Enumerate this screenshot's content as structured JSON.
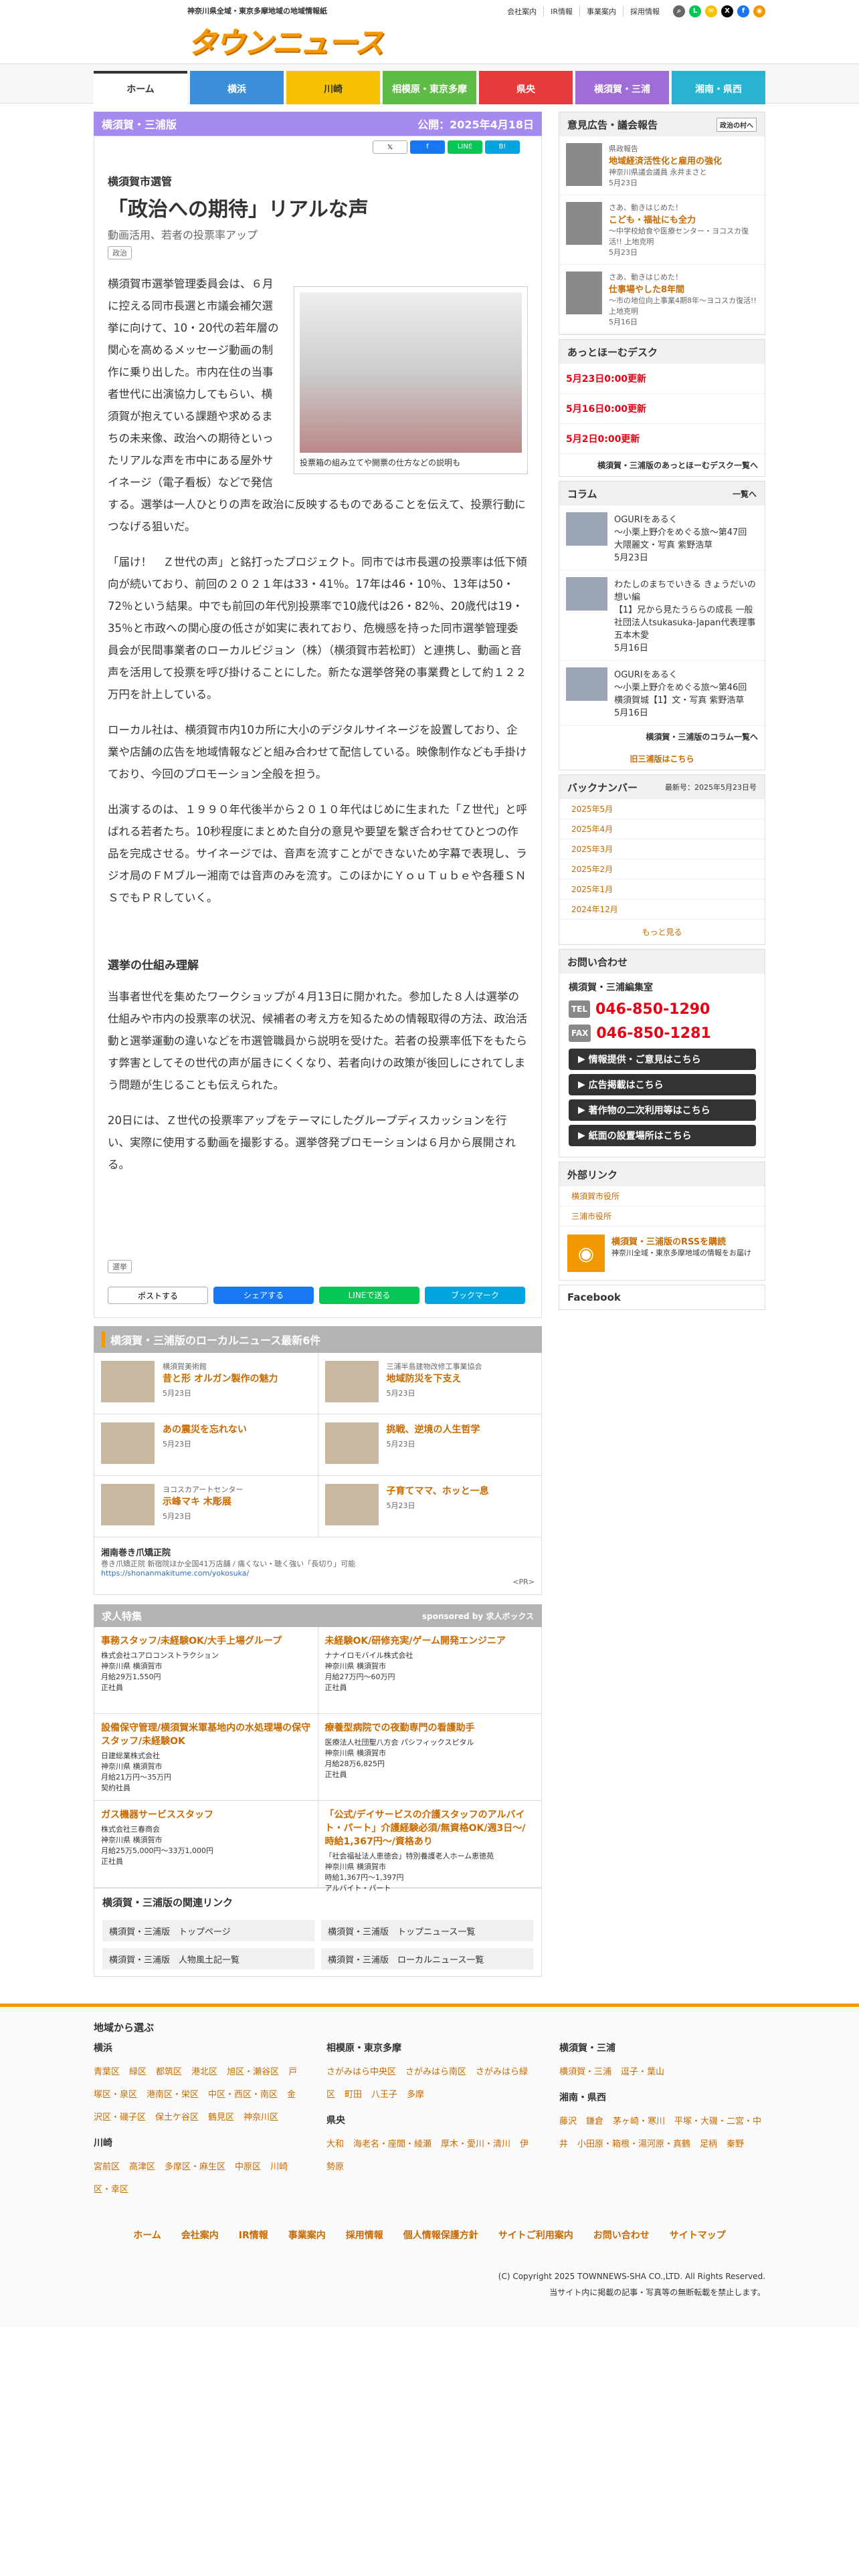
{
  "header": {
    "tagline": "神奈川県全域・東京多摩地域の地域情報紙",
    "logo": "タウンニュース",
    "links": [
      "会社案内",
      "IR情報",
      "事業案内",
      "採用情報"
    ]
  },
  "nav": [
    {
      "label": "ホーム",
      "color": "#333333"
    },
    {
      "label": "横浜",
      "color": "#3b8fd8"
    },
    {
      "label": "川崎",
      "color": "#f5c100"
    },
    {
      "label": "相模原・東京多摩",
      "color": "#5dbb46"
    },
    {
      "label": "県央",
      "color": "#e73a3a"
    },
    {
      "label": "横須賀・三浦",
      "color": "#a06cd5"
    },
    {
      "label": "湘南・県西",
      "color": "#29b3d3"
    }
  ],
  "article": {
    "edition": "横須賀・三浦版",
    "published": "公開：2025年4月18日",
    "category": "横須賀市選管",
    "title": "「政治への期待」リアルな声",
    "subtitle": "動画活用、若者の投票率アップ",
    "tag": "政治",
    "photo_caption": "投票箱の組み立てや開票の仕方などの説明も",
    "p1": "横須賀市選挙管理委員会は、６月に控える同市長選と市議会補欠選挙に向けて、10・20代の若年層の関心を高めるメッセージ動画の制作に乗り出した。市内在住の当事者世代に出演協力してもらい、横須賀が抱えている課題や求めるまちの未来像、政治への期待といったリアルな声を市中にある屋外サイネージ（電子看板）などで発信する。選挙は一人ひとりの声を政治に反映するものであることを伝えて、投票行動につなげる狙いだ。",
    "p2": "「届け！　Ｚ世代の声」と銘打ったプロジェクト。同市では市長選の投票率は低下傾向が続いており、前回の２０２１年は33・41％。17年は46・10％、13年は50・72％という結果。中でも前回の年代別投票率で10歳代は26・82％、20歳代は19・35％と市政への関心度の低さが如実に表れており、危機感を持った同市選挙管理委員会が民間事業者のローカルビジョン（株）（横須賀市若松町）と連携し、動画と音声を活用して投票を呼び掛けることにした。新たな選挙啓発の事業費として約１２２万円を計上している。",
    "p3": "ローカル社は、横須賀市内10カ所に大小のデジタルサイネージを設置しており、企業や店舗の広告を地域情報などと組み合わせて配信している。映像制作なども手掛けており、今回のプロモーション全般を担う。",
    "p4": "出演するのは、１９９０年代後半から２０１０年代はじめに生まれた「Ｚ世代」と呼ばれる若者たち。10秒程度にまとめた自分の意見や要望を繋ぎ合わせてひとつの作品を完成させる。サイネージでは、音声を流すことができないため字幕で表現し、ラジオ局のＦＭブルー湘南では音声のみを流す。このほかにＹｏｕＴｕｂｅや各種ＳＮＳでもＰＲしていく。",
    "h3": "選挙の仕組み理解",
    "p5": "当事者世代を集めたワークショップが４月13日に開かれた。参加した８人は選挙の仕組みや市内の投票率の状況、候補者の考え方を知るための情報取得の方法、政治活動と選挙運動の違いなどを市選管職員から説明を受けた。若者の投票率低下をもたらす弊害としてその世代の声が届きにくくなり、若者向けの政策が後回しにされてしまう問題が生じることも伝えられた。",
    "p6": "20日には、Ｚ世代の投票率アップをテーマにしたグループディスカッションを行い、実際に使用する動画を撮影する。選挙啓発プロモーションは６月から展開される。",
    "tag2": "選挙"
  },
  "share": {
    "x": "ポストする",
    "fb": "シェアする",
    "line": "LINEで送る",
    "hb": "ブックマーク"
  },
  "local": {
    "title": "横須賀・三浦版のローカルニュース最新6件",
    "items": [
      {
        "org": "横須賀美術館",
        "title": "昔と形 オルガン製作の魅力",
        "date": "5月23日"
      },
      {
        "org": "三浦半島建物改修工事業協会",
        "title": "地域防災を下支え",
        "date": "5月23日"
      },
      {
        "org": "",
        "title": "あの震災を忘れない",
        "date": "5月23日"
      },
      {
        "org": "",
        "title": "挑戦、逆境の人生哲学",
        "date": "5月23日"
      },
      {
        "org": "ヨコスカアートセンター",
        "title": "示峰マキ 木彫展",
        "date": "5月23日"
      },
      {
        "org": "",
        "title": "子育てママ、ホッと一息",
        "date": "5月23日"
      }
    ],
    "ad_title": "湘南巻き爪矯正院",
    "ad_text": "巻き爪矯正院 新宿院ほか全国41万店舗 / 痛くない・聴く強い「長切り」可能",
    "ad_url": "https://shonanmakitume.com/yokosuka/",
    "pr": "<PR>"
  },
  "jobs": {
    "title": "求人特集",
    "sponsor": "sponsored by 求人ボックス",
    "items": [
      {
        "t": "事務スタッフ/未経験OK/大手上場グループ",
        "co": "株式会社ユアロコンストラクション",
        "loc": "神奈川県 横須賀市",
        "pay": "月給29万1,550円",
        "type": "正社員"
      },
      {
        "t": "未経験OK/研修充実/ゲーム開発エンジニア",
        "co": "ナナイロモバイル株式会社",
        "loc": "神奈川県 横須賀市",
        "pay": "月給27万円〜60万円",
        "type": "正社員"
      },
      {
        "t": "設備保守管理/横須賀米軍基地内の水処理場の保守スタッフ/未経験OK",
        "co": "日建総業株式会社",
        "loc": "神奈川県 横須賀市",
        "pay": "月給21万円〜35万円",
        "type": "契約社員"
      },
      {
        "t": "療養型病院での夜勤専門の看護助手",
        "co": "医療法人社団聖八方会 パシフィックスピタル",
        "loc": "神奈川県 横須賀市",
        "pay": "月給28万6,825円",
        "type": "正社員"
      },
      {
        "t": "ガス機器サービススタッフ",
        "co": "株式会社三春商会",
        "loc": "神奈川県 横須賀市",
        "pay": "月給25万5,000円〜33万1,000円",
        "type": "正社員"
      },
      {
        "t": "「公式/デイサービスの介護スタッフのアルバイト・パート」介護経験必須/無資格OK/週3日〜/時給1,367円〜/資格あり",
        "co": "「社会福祉法人恵徳会」特別養護老人ホーム恵徳苑",
        "loc": "神奈川県 横須賀市",
        "pay": "時給1,367円〜1,397円",
        "type": "アルバイト・パート"
      }
    ]
  },
  "related": {
    "title": "横須賀・三浦版の関連リンク",
    "items": [
      "横須賀・三浦版　トップページ",
      "横須賀・三浦版　トップニュース一覧",
      "横須賀・三浦版　人物風土記一覧",
      "横須賀・三浦版　ローカルニュース一覧"
    ]
  },
  "side": {
    "ad_title": "意見広告・議会報告",
    "ad_more": "政治の村へ",
    "ads": [
      {
        "label": "県政報告",
        "title": "地域経済活性化と雇用の強化",
        "sub": "神奈川県議会議員 永井まさと",
        "date": "5月23日"
      },
      {
        "label": "さあ、動きはじめた！",
        "title": "こども・福祉にも全力",
        "sub": "〜中学校給食や医療センター・ヨコスカ復活!! 上地克明",
        "date": "5月23日"
      },
      {
        "label": "さあ、動きはじめた！",
        "title": "仕事場やした8年間",
        "sub": "〜市の地位向上事業4期8年〜ヨコスカ復活!! 上地克明",
        "date": "5月16日"
      }
    ],
    "desk_title": "あっとほーむデスク",
    "desk": [
      "5月23日0:00更新",
      "5月16日0:00更新",
      "5月2日0:00更新"
    ],
    "desk_more": "横須賀・三浦版のあっとほーむデスク一覧へ",
    "col_title": "コラム",
    "col_more": "一覧へ",
    "cols": [
      {
        "title": "OGURIをあるく",
        "sub": "〜小栗上野介をめぐる旅〜第47回 大隈麗文・写真 紫野浩草",
        "date": "5月23日"
      },
      {
        "title": "わたしのまちでいきる きょうだいの想い編",
        "sub": "【1】兄から見たうららの成長 一般社団法人tsukasuka-Japan代表理事 五本木愛",
        "date": "5月16日"
      },
      {
        "title": "OGURIをあるく",
        "sub": "〜小栗上野介をめぐる旅〜第46回 横須賀城【1】文・写真 紫野浩草",
        "date": "5月16日"
      }
    ],
    "col_more2": "横須賀・三浦版のコラム一覧へ",
    "old": "旧三浦版はこちら",
    "back_title": "バックナンバー",
    "back_latest": "最新号：2025年5月23日号",
    "back": [
      "2025年5月",
      "2025年4月",
      "2025年3月",
      "2025年2月",
      "2025年1月",
      "2024年12月"
    ],
    "back_more": "もっと見る",
    "contact_title": "お問い合わせ",
    "office": "横須賀・三浦編集室",
    "tel": "046-850-1290",
    "fax": "046-850-1281",
    "btns": [
      "情報提供・ご意見はこちら",
      "広告掲載はこちら",
      "著作物の二次利用等はこちら",
      "紙面の設置場所はこちら"
    ],
    "ext_title": "外部リンク",
    "ext": [
      "横須賀市役所",
      "三浦市役所"
    ],
    "rss_title": "横須賀・三浦版のRSSを購読",
    "rss_text": "神奈川全域・東京多摩地域の情報をお届け",
    "fb_title": "Facebook"
  },
  "footer": {
    "title": "地域から選ぶ",
    "yokohama": "横浜",
    "yokohama_links": [
      "青葉区",
      "緑区",
      "都筑区",
      "港北区",
      "旭区・瀬谷区",
      "戸塚区・泉区",
      "港南区・栄区",
      "中区・西区・南区",
      "金沢区・磯子区",
      "保土ケ谷区",
      "鶴見区",
      "神奈川区"
    ],
    "kawasaki": "川崎",
    "kawasaki_links": [
      "宮前区",
      "高津区",
      "多摩区・麻生区",
      "中原区",
      "川崎区・幸区"
    ],
    "sagami": "相模原・東京多摩",
    "sagami_links": [
      "さがみはら中央区",
      "さがみはら南区",
      "さがみはら緑区",
      "町田",
      "八王子",
      "多摩"
    ],
    "kenou": "県央",
    "kenou_links": [
      "大和",
      "海老名・座間・綾瀬",
      "厚木・愛川・清川",
      "伊勢原"
    ],
    "miura": "横須賀・三浦",
    "miura_links": [
      "横須賀・三浦",
      "逗子・葉山"
    ],
    "shonan": "湘南・県西",
    "shonan_links": [
      "藤沢",
      "鎌倉",
      "茅ヶ崎・寒川",
      "平塚・大磯・二宮・中井",
      "小田原・箱根・湯河原・真鶴",
      "足柄",
      "秦野"
    ],
    "nav": [
      "ホーム",
      "会社案内",
      "IR情報",
      "事業案内",
      "採用情報",
      "個人情報保護方針",
      "サイトご利用案内",
      "お問い合わせ",
      "サイトマップ"
    ],
    "copy": "(C) Copyright 2025 TOWNNEWS-SHA CO.,LTD. All Rights Reserved.",
    "copy2": "当サイト内に掲載の記事・写真等の無断転載を禁止します。"
  }
}
